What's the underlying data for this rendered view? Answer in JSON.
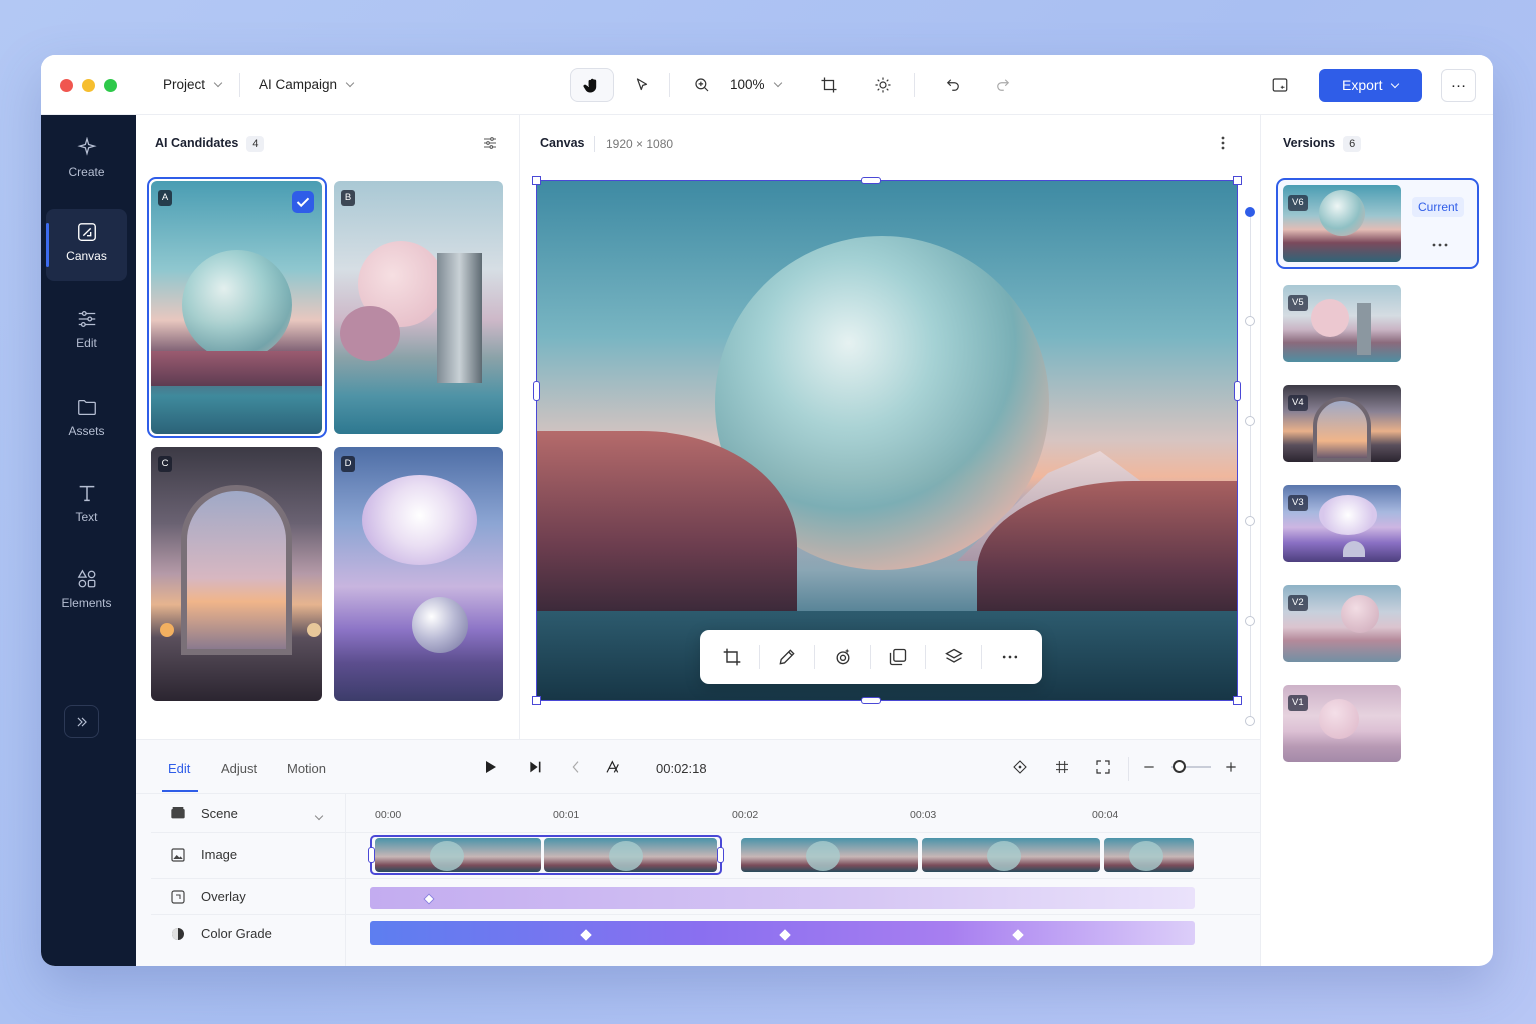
{
  "titlebar": {
    "project_label": "Project",
    "campaign_label": "AI Campaign",
    "zoom_level": "100%",
    "export_label": "Export",
    "more_label": "…"
  },
  "sidebar": {
    "items": [
      {
        "label": "Create",
        "icon": "sparkle-icon"
      },
      {
        "label": "Canvas",
        "icon": "canvas-icon",
        "active": true
      },
      {
        "label": "Edit",
        "icon": "sliders-icon"
      },
      {
        "label": "Assets",
        "icon": "folder-icon"
      },
      {
        "label": "Text",
        "icon": "text-icon"
      },
      {
        "label": "Elements",
        "icon": "shapes-icon"
      }
    ],
    "expand_icon": "double-chevron-right-icon"
  },
  "candidates": {
    "title": "AI Candidates",
    "count": "4",
    "items": [
      {
        "label": "A",
        "selected": true
      },
      {
        "label": "B",
        "selected": false
      },
      {
        "label": "C",
        "selected": false
      },
      {
        "label": "D",
        "selected": false
      }
    ]
  },
  "canvas": {
    "title": "Canvas",
    "dimensions": "1920 × 1080"
  },
  "versions": {
    "title": "Versions",
    "count": "6",
    "current_label": "Current",
    "items": [
      "V6",
      "V5",
      "V4",
      "V3",
      "V2",
      "V1"
    ]
  },
  "timeline": {
    "tabs": [
      "Edit",
      "Adjust",
      "Motion"
    ],
    "active_tab": "Edit",
    "timecode": "00:02:18",
    "ticks": [
      "00:00",
      "00:01",
      "00:02",
      "00:03",
      "00:04"
    ],
    "scene_label": "Scene",
    "tracks": [
      "Image",
      "Overlay",
      "Color Grade"
    ],
    "zoom_level": 0.2
  },
  "colors": {
    "accent": "#2f5de8",
    "sidebar": "#0f1b33",
    "selection": "#4a48d6"
  }
}
